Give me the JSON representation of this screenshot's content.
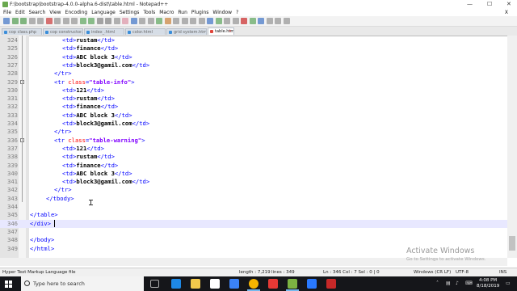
{
  "window": {
    "title": "F:\\bootstrap\\bootstrap-4.0.0-alpha.6-dist\\table.html - Notepad++",
    "controls": [
      "—",
      "☐",
      "✕"
    ]
  },
  "menu": [
    "File",
    "Edit",
    "Search",
    "View",
    "Encoding",
    "Language",
    "Settings",
    "Tools",
    "Macro",
    "Run",
    "Plugins",
    "Window",
    "?"
  ],
  "menu_close": "X",
  "tabs": [
    {
      "label": "cop class.php",
      "active": false
    },
    {
      "label": "cop constructor.php",
      "active": false
    },
    {
      "label": "index_.html",
      "active": false
    },
    {
      "label": "color.html",
      "active": false
    },
    {
      "label": "grid system.html",
      "active": false
    },
    {
      "label": "table.html",
      "active": true
    }
  ],
  "editor": {
    "current_line": 346,
    "lines": [
      {
        "n": "324",
        "indent": 4,
        "parts": [
          [
            "tag",
            "<td>"
          ],
          [
            "txt",
            "rustam"
          ],
          [
            "tag",
            "</td>"
          ]
        ]
      },
      {
        "n": "325",
        "indent": 4,
        "parts": [
          [
            "tag",
            "<td>"
          ],
          [
            "txt",
            "finance"
          ],
          [
            "tag",
            "</td>"
          ]
        ]
      },
      {
        "n": "326",
        "indent": 4,
        "parts": [
          [
            "tag",
            "<td>"
          ],
          [
            "txt",
            "ABC block 3"
          ],
          [
            "tag",
            "</td>"
          ]
        ]
      },
      {
        "n": "327",
        "indent": 4,
        "parts": [
          [
            "tag",
            "<td>"
          ],
          [
            "txt",
            "block3@gamil.com"
          ],
          [
            "tag",
            "</td>"
          ]
        ]
      },
      {
        "n": "328",
        "indent": 3,
        "parts": [
          [
            "tag",
            "</tr>"
          ]
        ]
      },
      {
        "n": "329",
        "indent": 3,
        "parts": [
          [
            "tag",
            "<tr "
          ],
          [
            "attr",
            "class"
          ],
          [
            "tag",
            "="
          ],
          [
            "val",
            "\"table-info\""
          ],
          [
            "tag",
            ">"
          ]
        ]
      },
      {
        "n": "330",
        "indent": 4,
        "parts": [
          [
            "tag",
            "<td>"
          ],
          [
            "txt",
            "121"
          ],
          [
            "tag",
            "</td>"
          ]
        ]
      },
      {
        "n": "331",
        "indent": 4,
        "parts": [
          [
            "tag",
            "<td>"
          ],
          [
            "txt",
            "rustam"
          ],
          [
            "tag",
            "</td>"
          ]
        ]
      },
      {
        "n": "332",
        "indent": 4,
        "parts": [
          [
            "tag",
            "<td>"
          ],
          [
            "txt",
            "finance"
          ],
          [
            "tag",
            "</td>"
          ]
        ]
      },
      {
        "n": "333",
        "indent": 4,
        "parts": [
          [
            "tag",
            "<td>"
          ],
          [
            "txt",
            "ABC block 3"
          ],
          [
            "tag",
            "</td>"
          ]
        ]
      },
      {
        "n": "334",
        "indent": 4,
        "parts": [
          [
            "tag",
            "<td>"
          ],
          [
            "txt",
            "block3@gamil.com"
          ],
          [
            "tag",
            "</td>"
          ]
        ]
      },
      {
        "n": "335",
        "indent": 3,
        "parts": [
          [
            "tag",
            "</tr>"
          ]
        ]
      },
      {
        "n": "336",
        "indent": 3,
        "parts": [
          [
            "tag",
            "<tr "
          ],
          [
            "attr",
            "class"
          ],
          [
            "tag",
            "="
          ],
          [
            "val",
            "\"table-warning\""
          ],
          [
            "tag",
            ">"
          ]
        ]
      },
      {
        "n": "337",
        "indent": 4,
        "parts": [
          [
            "tag",
            "<td>"
          ],
          [
            "txt",
            "121"
          ],
          [
            "tag",
            "</td>"
          ]
        ]
      },
      {
        "n": "338",
        "indent": 4,
        "parts": [
          [
            "tag",
            "<td>"
          ],
          [
            "txt",
            "rustam"
          ],
          [
            "tag",
            "</td>"
          ]
        ]
      },
      {
        "n": "339",
        "indent": 4,
        "parts": [
          [
            "tag",
            "<td>"
          ],
          [
            "txt",
            "finance"
          ],
          [
            "tag",
            "</td>"
          ]
        ]
      },
      {
        "n": "340",
        "indent": 4,
        "parts": [
          [
            "tag",
            "<td>"
          ],
          [
            "txt",
            "ABC block 3"
          ],
          [
            "tag",
            "</td>"
          ]
        ]
      },
      {
        "n": "341",
        "indent": 4,
        "parts": [
          [
            "tag",
            "<td>"
          ],
          [
            "txt",
            "block3@gamil.com"
          ],
          [
            "tag",
            "</td>"
          ]
        ]
      },
      {
        "n": "342",
        "indent": 3,
        "parts": [
          [
            "tag",
            "</tr>"
          ]
        ]
      },
      {
        "n": "343",
        "indent": 2,
        "parts": [
          [
            "tag",
            "</tbody>"
          ]
        ]
      },
      {
        "n": "344",
        "indent": 0,
        "parts": []
      },
      {
        "n": "345",
        "indent": 0,
        "parts": [
          [
            "tag",
            "</table>"
          ]
        ]
      },
      {
        "n": "346",
        "indent": 0,
        "parts": [
          [
            "tag",
            "</div>"
          ]
        ]
      },
      {
        "n": "347",
        "indent": 0,
        "parts": []
      },
      {
        "n": "348",
        "indent": 0,
        "parts": [
          [
            "tag",
            "</body>"
          ]
        ]
      },
      {
        "n": "349",
        "indent": 0,
        "parts": [
          [
            "tag",
            "</html>"
          ]
        ]
      }
    ]
  },
  "status": {
    "file_type": "Hyper Text Markup Language file",
    "length": "length : 7,219",
    "lines": "lines : 349",
    "position": "Ln : 346    Col : 7    Sel : 0 | 0",
    "eol": "Windows (CR LF)",
    "encoding": "UTF-8",
    "mode": "INS"
  },
  "watermark": {
    "title": "Activate Windows",
    "subtitle": "Go to Settings to activate Windows."
  },
  "taskbar": {
    "search_placeholder": "Type here to search",
    "time": "4:08 PM",
    "date": "8/18/2019"
  },
  "colors": {
    "tag": "#0000ff",
    "attr": "#ff0000",
    "value": "#8000ff",
    "current_line": "#e8e8ff",
    "taskbar": "#15161a"
  }
}
